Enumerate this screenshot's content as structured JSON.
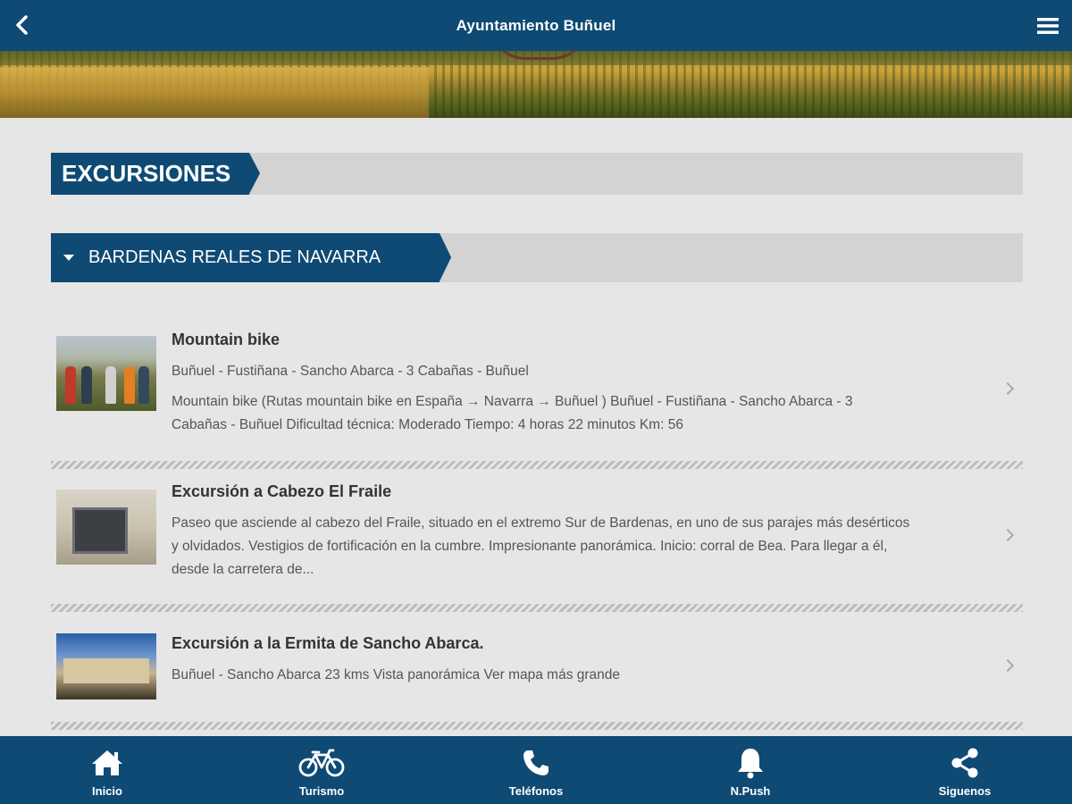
{
  "header": {
    "title": "Ayuntamiento Buñuel"
  },
  "section": {
    "title": "EXCURSIONES"
  },
  "category": {
    "title": "BARDENAS REALES DE NAVARRA"
  },
  "items": [
    {
      "name": "Mountain bike",
      "lines": [
        "Buñuel - Fustiñana - Sancho Abarca - 3 Cabañas - Buñuel"
      ],
      "description": [
        "Mountain bike (Rutas mountain bike en España → Navarra → Buñuel ) Buñuel - Fustiñana - Sancho Abarca - 3",
        "Cabañas - Buñuel  Dificultad técnica: Moderado Tiempo: 4 horas 22 minutos Km: 56"
      ]
    },
    {
      "name": "Excursión a Cabezo El Fraile",
      "description": [
        "Paseo que asciende al cabezo del Fraile, situado en el extremo Sur de Bardenas, en uno de sus parajes más desérticos",
        "y olvidados. Vestigios de fortificación en la cumbre. Impresionante panorámica. Inicio: corral de Bea. Para llegar a él,",
        "desde la carretera de..."
      ]
    },
    {
      "name": "Excursión a la Ermita de Sancho Abarca.",
      "description": [
        " Buñuel - Sancho Abarca 23 kms Vista panorámica Ver mapa más grande"
      ]
    }
  ],
  "tabs": [
    {
      "label": "Inicio",
      "icon": "home-icon"
    },
    {
      "label": "Turismo",
      "icon": "bicycle-icon"
    },
    {
      "label": "Teléfonos",
      "icon": "phone-icon"
    },
    {
      "label": "N.Push",
      "icon": "bell-icon"
    },
    {
      "label": "Siguenos",
      "icon": "share-icon"
    }
  ],
  "colors": {
    "primary": "#0e4a74",
    "background": "#e6e6e6",
    "header_strip": "#d3d3d3"
  }
}
